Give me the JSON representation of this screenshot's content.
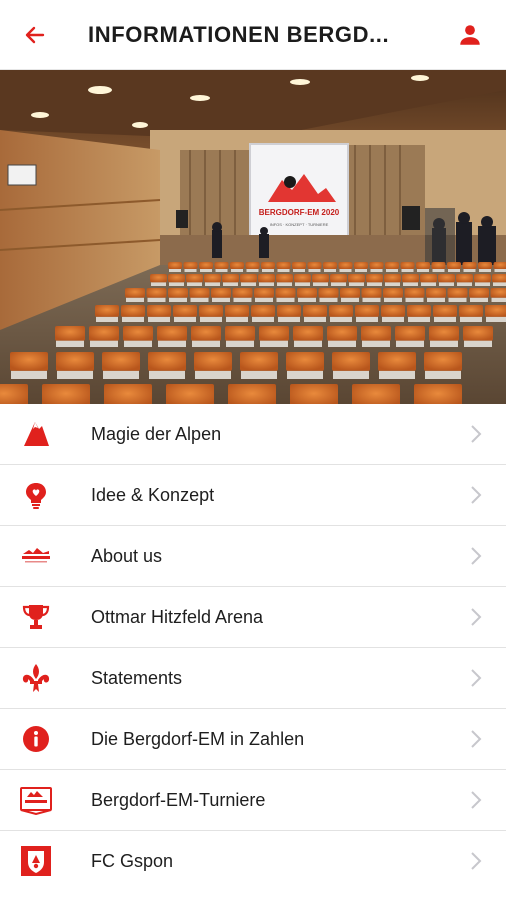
{
  "header": {
    "title": "INFORMATIONEN BERGD...",
    "accent": "#e0211d"
  },
  "hero": {
    "screen_line1": "BERGDORF-EM 2020",
    "screen_line2": "INFOS · KONZEPT · TURNIERE"
  },
  "menu": {
    "items": [
      {
        "label": "Magie der Alpen",
        "icon": "mountain-icon"
      },
      {
        "label": "Idee & Konzept",
        "icon": "lightbulb-heart-icon"
      },
      {
        "label": "About us",
        "icon": "logo-icon"
      },
      {
        "label": "Ottmar Hitzfeld Arena",
        "icon": "trophy-icon"
      },
      {
        "label": "Statements",
        "icon": "fleur-de-lis-icon"
      },
      {
        "label": "Die Bergdorf-EM in Zahlen",
        "icon": "info-icon"
      },
      {
        "label": "Bergdorf-EM-Turniere",
        "icon": "tournament-badge-icon"
      },
      {
        "label": "FC Gspon",
        "icon": "club-crest-icon"
      }
    ]
  }
}
